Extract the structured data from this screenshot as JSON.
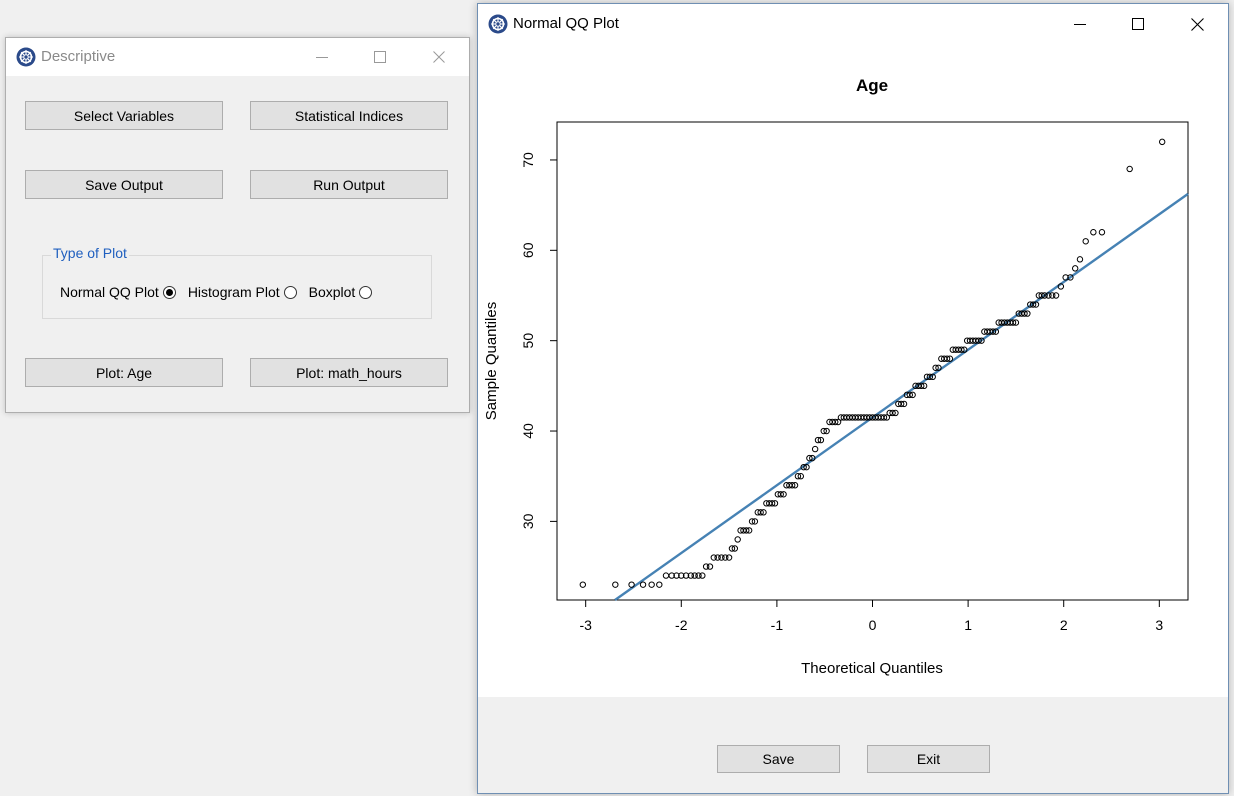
{
  "descriptive_window": {
    "title": "Descriptive",
    "buttons": {
      "select_variables": "Select Variables",
      "statistical_indices": "Statistical Indices",
      "save_output": "Save Output",
      "run_output": "Run Output",
      "plot_age": "Plot: Age",
      "plot_math_hours": "Plot: math_hours"
    },
    "plot_type_group": {
      "legend": "Type of Plot",
      "options": [
        {
          "label": "Normal QQ Plot",
          "selected": true
        },
        {
          "label": "Histogram Plot",
          "selected": false
        },
        {
          "label": "Boxplot",
          "selected": false
        }
      ]
    }
  },
  "qq_window": {
    "title": "Normal QQ Plot",
    "save_label": "Save",
    "exit_label": "Exit"
  },
  "chart_data": {
    "type": "scatter",
    "title": "Age",
    "xlabel": "Theoretical Quantiles",
    "ylabel": "Sample Quantiles",
    "xlim": [
      -3.3,
      3.3
    ],
    "ylim": [
      21.3,
      74.2
    ],
    "xticks": [
      -3,
      -2,
      -1,
      0,
      1,
      2,
      3
    ],
    "yticks": [
      30,
      40,
      50,
      60,
      70
    ],
    "reference_line": {
      "slope": 7.5,
      "intercept": 41.5,
      "color": "#4682b4"
    },
    "series": [
      {
        "points": [
          [
            -3.03,
            23
          ],
          [
            -2.69,
            23
          ],
          [
            -2.52,
            23
          ],
          [
            -2.4,
            23
          ],
          [
            -2.31,
            23
          ],
          [
            -2.23,
            23
          ],
          [
            -2.16,
            24
          ],
          [
            -2.1,
            24
          ],
          [
            -2.05,
            24
          ],
          [
            -2.0,
            24
          ],
          [
            -1.95,
            24
          ],
          [
            -1.9,
            24
          ],
          [
            -1.86,
            24
          ],
          [
            -1.82,
            24
          ],
          [
            -1.78,
            24
          ],
          [
            -1.74,
            25
          ],
          [
            -1.7,
            25
          ],
          [
            -1.66,
            26
          ],
          [
            -1.62,
            26
          ],
          [
            -1.58,
            26
          ],
          [
            -1.54,
            26
          ],
          [
            -1.5,
            26
          ],
          [
            -1.47,
            27
          ],
          [
            -1.44,
            27
          ],
          [
            -1.41,
            28
          ],
          [
            -1.38,
            29
          ],
          [
            -1.35,
            29
          ],
          [
            -1.32,
            29
          ],
          [
            -1.29,
            29
          ],
          [
            -1.26,
            30
          ],
          [
            -1.23,
            30
          ],
          [
            -1.2,
            31
          ],
          [
            -1.17,
            31
          ],
          [
            -1.14,
            31
          ],
          [
            -1.11,
            32
          ],
          [
            -1.08,
            32
          ],
          [
            -1.05,
            32
          ],
          [
            -1.02,
            32
          ],
          [
            -0.99,
            33
          ],
          [
            -0.96,
            33
          ],
          [
            -0.93,
            33
          ],
          [
            -0.9,
            34
          ],
          [
            -0.87,
            34
          ],
          [
            -0.84,
            34
          ],
          [
            -0.81,
            34
          ],
          [
            -0.78,
            35
          ],
          [
            -0.75,
            35
          ],
          [
            -0.72,
            36
          ],
          [
            -0.69,
            36
          ],
          [
            -0.66,
            37
          ],
          [
            -0.63,
            37
          ],
          [
            -0.6,
            38
          ],
          [
            -0.57,
            39
          ],
          [
            -0.54,
            39
          ],
          [
            -0.51,
            40
          ],
          [
            -0.48,
            40
          ],
          [
            -0.45,
            41
          ],
          [
            -0.42,
            41
          ],
          [
            -0.39,
            41
          ],
          [
            -0.36,
            41
          ],
          [
            -0.33,
            41.5
          ],
          [
            -0.3,
            41.5
          ],
          [
            -0.27,
            41.5
          ],
          [
            -0.24,
            41.5
          ],
          [
            -0.21,
            41.5
          ],
          [
            -0.18,
            41.5
          ],
          [
            -0.15,
            41.5
          ],
          [
            -0.12,
            41.5
          ],
          [
            -0.09,
            41.5
          ],
          [
            -0.06,
            41.5
          ],
          [
            -0.03,
            41.5
          ],
          [
            0.0,
            41.5
          ],
          [
            0.03,
            41.5
          ],
          [
            0.06,
            41.5
          ],
          [
            0.09,
            41.5
          ],
          [
            0.12,
            41.5
          ],
          [
            0.15,
            41.5
          ],
          [
            0.18,
            42
          ],
          [
            0.21,
            42
          ],
          [
            0.24,
            42
          ],
          [
            0.27,
            43
          ],
          [
            0.3,
            43
          ],
          [
            0.33,
            43
          ],
          [
            0.36,
            44
          ],
          [
            0.39,
            44
          ],
          [
            0.42,
            44
          ],
          [
            0.45,
            45
          ],
          [
            0.48,
            45
          ],
          [
            0.51,
            45
          ],
          [
            0.54,
            45
          ],
          [
            0.57,
            46
          ],
          [
            0.6,
            46
          ],
          [
            0.63,
            46
          ],
          [
            0.66,
            47
          ],
          [
            0.69,
            47
          ],
          [
            0.72,
            48
          ],
          [
            0.75,
            48
          ],
          [
            0.78,
            48
          ],
          [
            0.81,
            48
          ],
          [
            0.84,
            49
          ],
          [
            0.87,
            49
          ],
          [
            0.9,
            49
          ],
          [
            0.93,
            49
          ],
          [
            0.96,
            49
          ],
          [
            0.99,
            50
          ],
          [
            1.02,
            50
          ],
          [
            1.05,
            50
          ],
          [
            1.08,
            50
          ],
          [
            1.11,
            50
          ],
          [
            1.14,
            50
          ],
          [
            1.17,
            51
          ],
          [
            1.2,
            51
          ],
          [
            1.23,
            51
          ],
          [
            1.26,
            51
          ],
          [
            1.29,
            51
          ],
          [
            1.32,
            52
          ],
          [
            1.35,
            52
          ],
          [
            1.38,
            52
          ],
          [
            1.41,
            52
          ],
          [
            1.44,
            52
          ],
          [
            1.47,
            52
          ],
          [
            1.5,
            52
          ],
          [
            1.53,
            53
          ],
          [
            1.56,
            53
          ],
          [
            1.59,
            53
          ],
          [
            1.62,
            53
          ],
          [
            1.65,
            54
          ],
          [
            1.68,
            54
          ],
          [
            1.71,
            54
          ],
          [
            1.74,
            55
          ],
          [
            1.77,
            55
          ],
          [
            1.8,
            55
          ],
          [
            1.84,
            55
          ],
          [
            1.88,
            55
          ],
          [
            1.92,
            55
          ],
          [
            1.97,
            56
          ],
          [
            2.02,
            57
          ],
          [
            2.07,
            57
          ],
          [
            2.12,
            58
          ],
          [
            2.17,
            59
          ],
          [
            2.23,
            61
          ],
          [
            2.31,
            62
          ],
          [
            2.4,
            62
          ],
          [
            2.69,
            69
          ],
          [
            3.03,
            72
          ]
        ]
      }
    ]
  }
}
